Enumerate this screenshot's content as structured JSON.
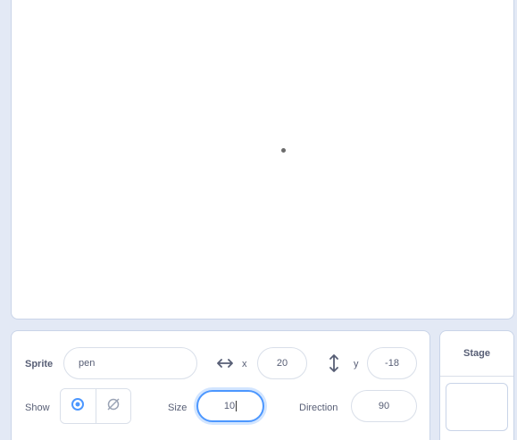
{
  "sprite_info": {
    "sprite_label": "Sprite",
    "sprite_name": "pen",
    "x_label": "x",
    "x_value": "20",
    "y_label": "y",
    "y_value": "-18",
    "show_label": "Show",
    "size_label": "Size",
    "size_value": "10",
    "direction_label": "Direction",
    "direction_value": "90"
  },
  "stage_panel": {
    "title": "Stage"
  },
  "icons": {
    "x_arrow": "horizontal-arrows-icon",
    "y_arrow": "vertical-arrows-icon",
    "show_visible": "eye-icon",
    "show_hidden": "eye-crossed-icon"
  },
  "colors": {
    "accent": "#4c97ff",
    "text": "#575e75",
    "border": "#d9dfe9",
    "background": "#e3e9f5"
  }
}
